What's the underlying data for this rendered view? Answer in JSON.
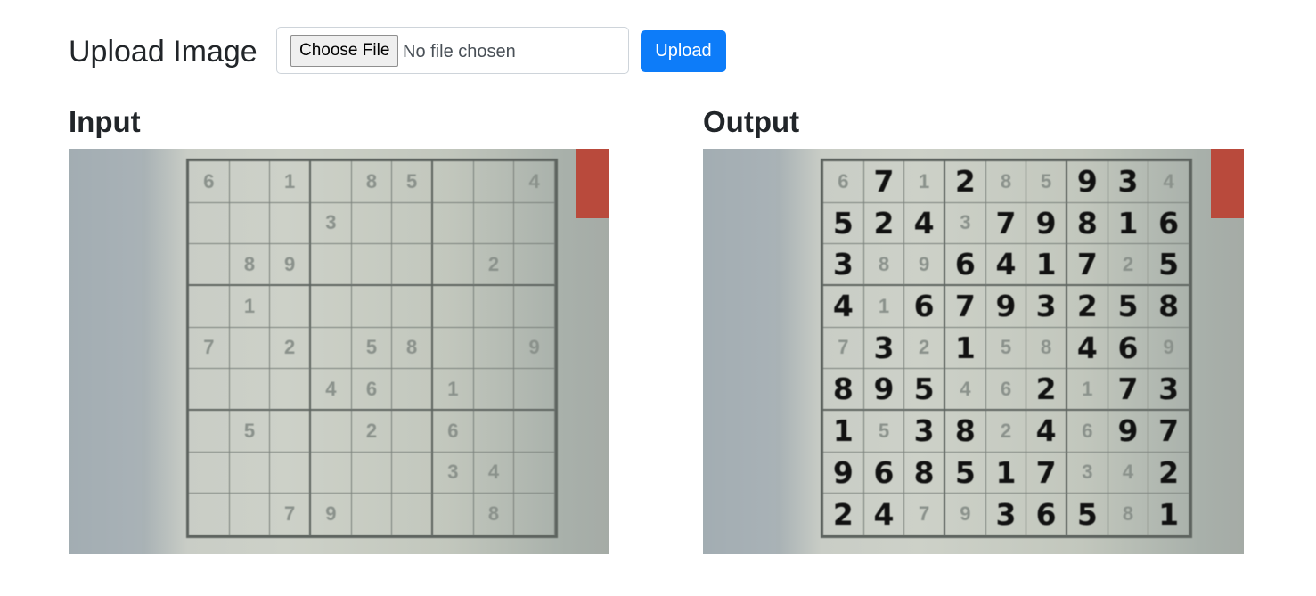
{
  "upload": {
    "title": "Upload Image",
    "choose_file_label": "Choose File",
    "no_file_text": "No file chosen",
    "upload_button_label": "Upload",
    "accent_color": "#0d7cf9"
  },
  "panels": {
    "input_title": "Input",
    "output_title": "Output"
  },
  "puzzle": {
    "given": [
      [
        "6",
        "",
        "1",
        "",
        "8",
        "5",
        "",
        "",
        "4"
      ],
      [
        "",
        "",
        "",
        "3",
        "",
        "",
        "",
        "",
        ""
      ],
      [
        "",
        "8",
        "9",
        "",
        "",
        "",
        "",
        "2",
        ""
      ],
      [
        "",
        "1",
        "",
        "",
        "",
        "",
        "",
        "",
        ""
      ],
      [
        "7",
        "",
        "2",
        "",
        "5",
        "8",
        "",
        "",
        "9"
      ],
      [
        "",
        "",
        "",
        "4",
        "6",
        "",
        "1",
        "",
        ""
      ],
      [
        "",
        "5",
        "",
        "",
        "2",
        "",
        "6",
        "",
        ""
      ],
      [
        "",
        "",
        "",
        "",
        "",
        "",
        "3",
        "4",
        ""
      ],
      [
        "",
        "",
        "7",
        "9",
        "",
        "",
        "",
        "8",
        ""
      ]
    ],
    "solution": [
      [
        "6",
        "7",
        "1",
        "2",
        "8",
        "5",
        "9",
        "3",
        "4"
      ],
      [
        "5",
        "2",
        "4",
        "3",
        "7",
        "9",
        "8",
        "1",
        "6"
      ],
      [
        "3",
        "8",
        "9",
        "6",
        "4",
        "1",
        "7",
        "2",
        "5"
      ],
      [
        "4",
        "1",
        "6",
        "7",
        "9",
        "3",
        "2",
        "5",
        "8"
      ],
      [
        "7",
        "3",
        "2",
        "1",
        "5",
        "8",
        "4",
        "6",
        "9"
      ],
      [
        "8",
        "9",
        "5",
        "4",
        "6",
        "2",
        "1",
        "7",
        "3"
      ],
      [
        "1",
        "5",
        "3",
        "8",
        "2",
        "4",
        "6",
        "9",
        "7"
      ],
      [
        "9",
        "6",
        "8",
        "5",
        "1",
        "7",
        "3",
        "4",
        "2"
      ],
      [
        "2",
        "4",
        "7",
        "9",
        "3",
        "6",
        "5",
        "8",
        "1"
      ]
    ]
  }
}
